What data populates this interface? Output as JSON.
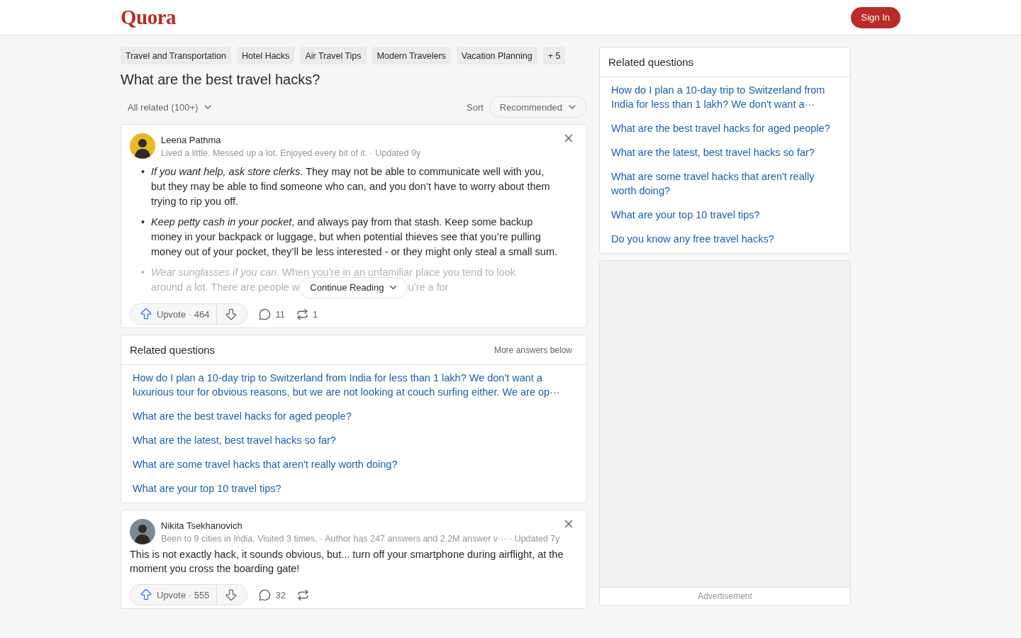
{
  "header": {
    "logo": "Quora",
    "sign_in": "Sign In"
  },
  "topics": [
    "Travel and Transportation",
    "Hotel Hacks",
    "Air Travel Tips",
    "Modern Travelers",
    "Vacation Planning"
  ],
  "more_topics": "+ 5",
  "question": "What are the best travel hacks?",
  "filter": "All related (100+)",
  "sort": {
    "label": "Sort",
    "value": "Recommended"
  },
  "answers": [
    {
      "author": "Leena Pathma",
      "bullet": "•",
      "credential": "Lived a little. Messed up a lot. Enjoyed every bit of it. · Updated 9y",
      "kind": "list",
      "items": [
        "*If you want help, ask store clerks*. They may not be able to communicate well with you, but they may be able to find someone who can, and you don’t have to worry about them trying to rip you off.",
        "*Keep petty cash in your pocket*, and always pay from that stash. Keep some backup money in your backpack or luggage, but when potential thieves see that you’re pulling money out of your pocket, they’ll be less interested - or they might only steal a small sum."
      ],
      "faded": {
        "text": "*Wear sunglasses if you can*. When you’re in an unfamiliar place you tend to look",
        "before": "around a lot. There are people w",
        "after": "u’re a for"
      },
      "continue": "Continue Reading",
      "upvote": "Upvote · 464",
      "comments": "11",
      "shares": "1"
    },
    {
      "author": "Nikita Tsekhanovich",
      "credential": "Been to 9 cities in India. Visited 3 times. · Author has 247 answers and 2.2M answer v···",
      "updated": "· Updated 7y",
      "kind": "paragraph",
      "text": "This is not exactly hack, it sounds obvious, but... turn off your smartphone during airflight, at the moment you cross the boarding gate!",
      "upvote": "Upvote · 555",
      "comments": "32"
    }
  ],
  "inline_related": {
    "title": "Related questions",
    "note": "More answers below",
    "links": [
      "How do I plan a 10-day trip to Switzerland from India for less than 1 lakh? We don't want a luxurious tour for obvious reasons, but we are not looking at couch surfing either. We are op···",
      "What are the best travel hacks for aged people?",
      "What are the latest, best travel hacks so far?",
      "What are some travel hacks that aren't really worth doing?",
      "What are your top 10 travel tips?"
    ]
  },
  "sidebar_related": {
    "title": "Related questions",
    "links": [
      "How do I plan a 10-day trip to Switzerland from India for less than 1 lakh? We don't want a···",
      "What are the best travel hacks for aged people?",
      "What are the latest, best travel hacks so far?",
      "What are some travel hacks that aren't really worth doing?",
      "What are your top 10 travel tips?",
      "Do you know any free travel hacks?"
    ]
  },
  "advertisement": "Advertisement"
}
